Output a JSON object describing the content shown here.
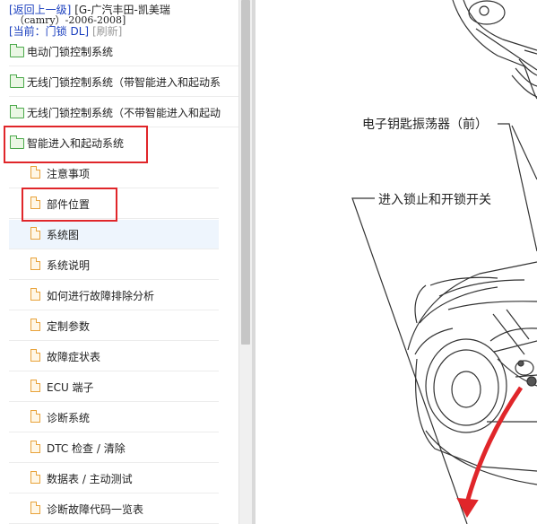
{
  "nav": {
    "back_link": "[返回上一级]",
    "vehicle_title": "[G-广汽丰田-凯美瑞",
    "vehicle_subtitle": "（camry）-2006-2008]",
    "current_link": "[当前：门锁 DL]",
    "refresh_link": "[刷新]"
  },
  "tree": {
    "folders": [
      {
        "label": "电动门锁控制系统"
      },
      {
        "label": "无线门锁控制系统（带智能进入和起动系"
      },
      {
        "label": "无线门锁控制系统（不带智能进入和起动"
      },
      {
        "label": "智能进入和起动系统"
      }
    ],
    "pages": [
      {
        "label": "注意事项"
      },
      {
        "label": "部件位置"
      },
      {
        "label": "系统图"
      },
      {
        "label": "系统说明"
      },
      {
        "label": "如何进行故障排除分析"
      },
      {
        "label": "定制参数"
      },
      {
        "label": "故障症状表"
      },
      {
        "label": "ECU 端子"
      },
      {
        "label": "诊断系统"
      },
      {
        "label": "DTC 检查 / 清除"
      },
      {
        "label": "数据表 / 主动测试"
      },
      {
        "label": "诊断故障代码一览表"
      }
    ],
    "selected_index": 2
  },
  "diagram": {
    "callout_front_oscillator": "电子钥匙振荡器（前）",
    "callout_entry_switch": "进入锁止和开锁开关"
  },
  "colors": {
    "link": "#1a3fbf",
    "highlight_border": "#e0262a",
    "folder_icon": "#4aa84a",
    "page_icon": "#e8a23a",
    "selected_row": "#eef5fd"
  }
}
